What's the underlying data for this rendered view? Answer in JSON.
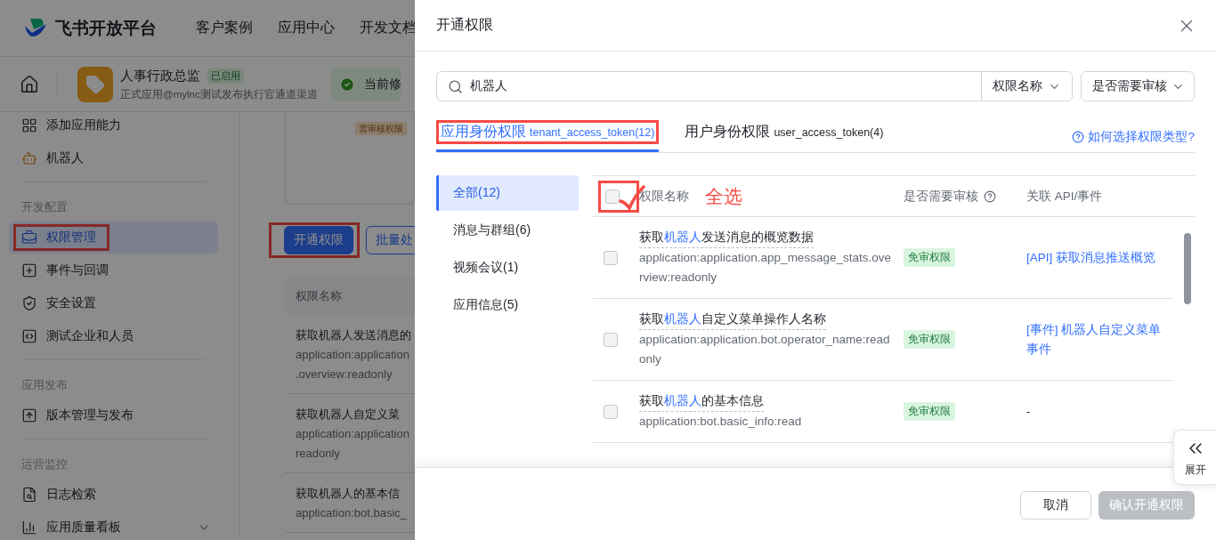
{
  "header": {
    "logo_text": "飞书开放平台",
    "nav": [
      "客户案例",
      "应用中心",
      "开发文档"
    ]
  },
  "app_bar": {
    "name": "人事行政总监",
    "status": "已启用",
    "subtitle": "正式应用@mylnc测试发布执行官通道渠道",
    "notice": "当前修"
  },
  "sidebar": {
    "groups": [
      {
        "items": [
          {
            "label": "添加应用能力",
            "selected": false,
            "annotated": false
          },
          {
            "label": "机器人",
            "selected": false,
            "annotated": false
          }
        ]
      },
      {
        "heading": "开发配置",
        "items": [
          {
            "label": "权限管理",
            "selected": true,
            "annotated": true
          },
          {
            "label": "事件与回调",
            "selected": false,
            "annotated": false
          },
          {
            "label": "安全设置",
            "selected": false,
            "annotated": false
          },
          {
            "label": "测试企业和人员",
            "selected": false,
            "annotated": false
          }
        ]
      },
      {
        "heading": "应用发布",
        "items": [
          {
            "label": "版本管理与发布",
            "selected": false,
            "annotated": false
          }
        ]
      },
      {
        "heading": "运营监控",
        "items": [
          {
            "label": "日志检索",
            "selected": false,
            "annotated": false
          },
          {
            "label": "应用质量看板",
            "selected": false,
            "annotated": false,
            "expanded": true
          }
        ]
      }
    ]
  },
  "content": {
    "card_tag": "需审核权限",
    "buttons": [
      {
        "label": "开通权限",
        "kind": "primary",
        "annotated": true
      },
      {
        "label": "批量处",
        "kind": "outline",
        "annotated": false
      }
    ],
    "table_header": "权限名称",
    "rows": [
      {
        "lines": [
          "获取机器人发送消息的",
          "application:application",
          ".overview:readonly"
        ]
      },
      {
        "lines": [
          "获取机器人自定义菜",
          "application:application",
          "readonly"
        ]
      },
      {
        "lines": [
          "获取机器人的基本信",
          "application:bot.basic_"
        ]
      }
    ]
  },
  "drawer": {
    "title": "开通权限",
    "search": {
      "value": "机器人",
      "field_select": "权限名称",
      "filter_select": "是否需要审核"
    },
    "tabs": [
      {
        "label": "应用身份权限",
        "token": "tenant_access_token(12)",
        "selected": true,
        "annotated": true
      },
      {
        "label": "用户身份权限",
        "token": "user_access_token(4)",
        "selected": false,
        "annotated": false
      }
    ],
    "help_link": "如何选择权限类型?",
    "categories": [
      {
        "label": "全部(12)",
        "selected": true
      },
      {
        "label": "消息与群组(6)",
        "selected": false
      },
      {
        "label": "视频会议(1)",
        "selected": false
      },
      {
        "label": "应用信息(5)",
        "selected": false
      }
    ],
    "columns": [
      "权限名称",
      "是否需要审核",
      "关联 API/事件"
    ],
    "select_all": {
      "checked": false,
      "annotated": true,
      "annotation": "全选"
    },
    "rows": [
      {
        "title": {
          "prefix": "获取",
          "keyword": "机器人",
          "suffix": "发送消息的概览数据"
        },
        "scope": "application:application.app_message_stats.overview:readonly",
        "review": "免审权限",
        "related": "[API] 获取消息推送概览",
        "checked": false
      },
      {
        "title": {
          "prefix": "获取",
          "keyword": "机器人",
          "suffix": "自定义菜单操作人名称"
        },
        "scope": "application:application.bot.operator_name:readonly",
        "review": "免审权限",
        "related": "[事件] 机器人自定义菜单事件",
        "checked": false
      },
      {
        "title": {
          "prefix": "获取",
          "keyword": "机器人",
          "suffix": "的基本信息"
        },
        "scope": "application:bot.basic_info:read",
        "review": "免审权限",
        "related": "-",
        "checked": false
      }
    ],
    "footer_buttons": [
      {
        "label": "取消",
        "kind": "cancel",
        "disabled": false
      },
      {
        "label": "确认开通权限",
        "kind": "confirm",
        "disabled": true
      }
    ],
    "expand_button": "展开"
  }
}
